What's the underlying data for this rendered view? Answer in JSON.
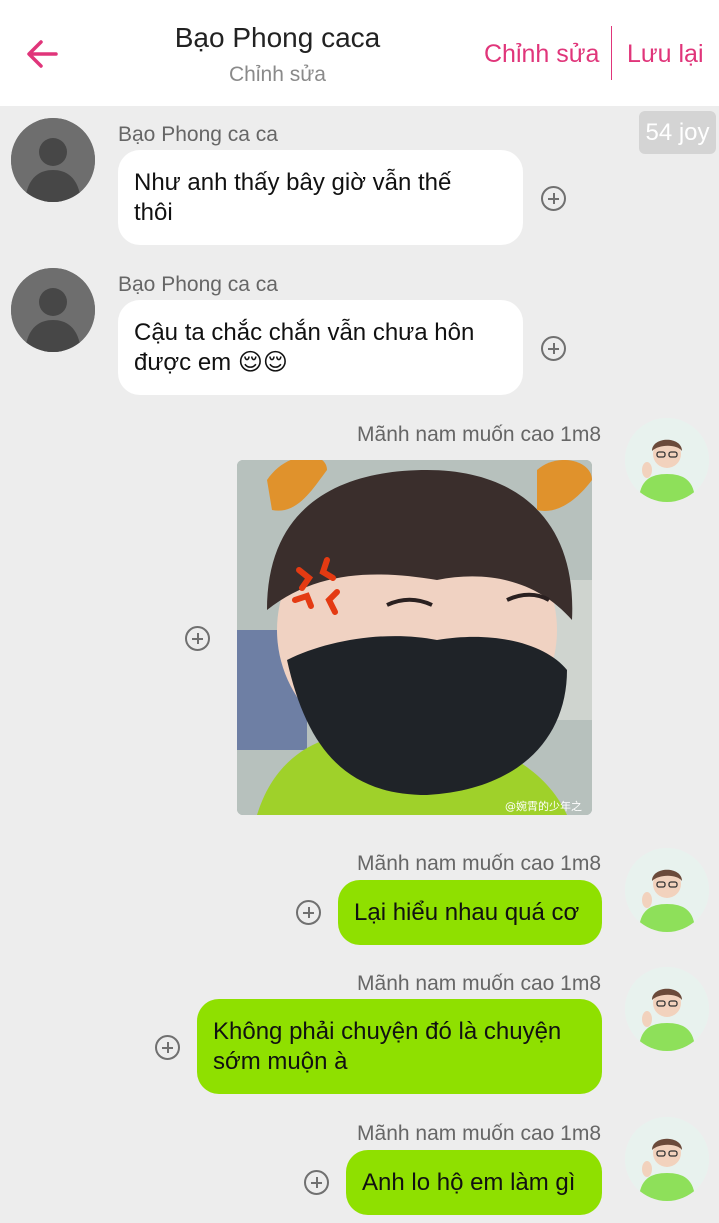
{
  "header": {
    "title": "Bạo Phong caca",
    "subtitle": "Chỉnh sửa",
    "edit_label": "Chỉnh sửa",
    "save_label": "Lưu lại",
    "accent_color": "#e0357a"
  },
  "badge": {
    "text": "54 joy"
  },
  "messages": [
    {
      "sender": "Bạo Phong ca ca",
      "side": "incoming",
      "type": "text",
      "text_line1": "Như anh thấy bây giờ vẫn thế",
      "text_line2": "thôi"
    },
    {
      "sender": "Bạo Phong ca ca",
      "side": "incoming",
      "type": "text",
      "text_line1": "Cậu ta chắc chắn vẫn chưa hôn",
      "text_line2": "được em 😌😌"
    },
    {
      "sender": "Mãnh nam muốn cao 1m8",
      "side": "outgoing",
      "type": "image",
      "watermark": "@婉霄的少年之"
    },
    {
      "sender": "Mãnh nam muốn cao 1m8",
      "side": "outgoing",
      "type": "text",
      "text": "Lại hiểu nhau quá cơ"
    },
    {
      "sender": "Mãnh nam muốn cao 1m8",
      "side": "outgoing",
      "type": "text",
      "text_line1": "Không phải chuyện đó là chuyện",
      "text_line2": "sớm muộn à"
    },
    {
      "sender": "Mãnh nam muốn cao 1m8",
      "side": "outgoing",
      "type": "text",
      "text": "Anh lo hộ em làm gì"
    }
  ],
  "colors": {
    "incoming_bubble": "#ffffff",
    "outgoing_bubble": "#8fe000",
    "background": "#ededed"
  },
  "icons": [
    "back-arrow-icon",
    "add-circle-icon",
    "default-avatar-icon",
    "user-avatar"
  ]
}
